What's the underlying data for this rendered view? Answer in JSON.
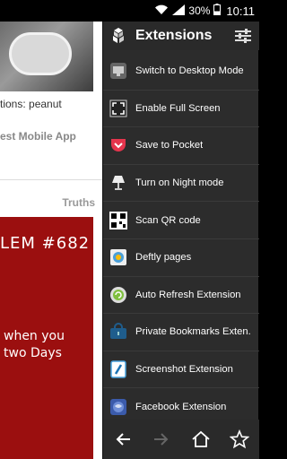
{
  "status_bar": {
    "battery": "30%",
    "time": "10:11"
  },
  "background_page": {
    "caption": "tions: peanut",
    "app_link": "est Mobile App",
    "section": "Truths",
    "card_title": "LEM #682",
    "card_line1": "when you",
    "card_line2": "two Days"
  },
  "drawer": {
    "title": "Extensions",
    "items": [
      {
        "label": "Switch to Desktop Mode",
        "icon": "desktop-icon"
      },
      {
        "label": "Enable Full Screen",
        "icon": "fullscreen-icon"
      },
      {
        "label": "Save to Pocket",
        "icon": "pocket-icon"
      },
      {
        "label": "Turn on Night mode",
        "icon": "lamp-icon"
      },
      {
        "label": "Scan QR code",
        "icon": "qr-code-icon"
      },
      {
        "label": "Deftly pages",
        "icon": "deftly-icon"
      },
      {
        "label": "Auto Refresh Extension",
        "icon": "refresh-icon"
      },
      {
        "label": "Private Bookmarks Exten.",
        "icon": "lock-icon"
      },
      {
        "label": "Screenshot Extension",
        "icon": "screenshot-icon"
      },
      {
        "label": "Facebook Extension",
        "icon": "facebook-icon"
      }
    ]
  },
  "colors": {
    "drawer_bg": "#2c2c2c",
    "pocket_red": "#e5354d",
    "card_red": "#9b0f0f"
  }
}
